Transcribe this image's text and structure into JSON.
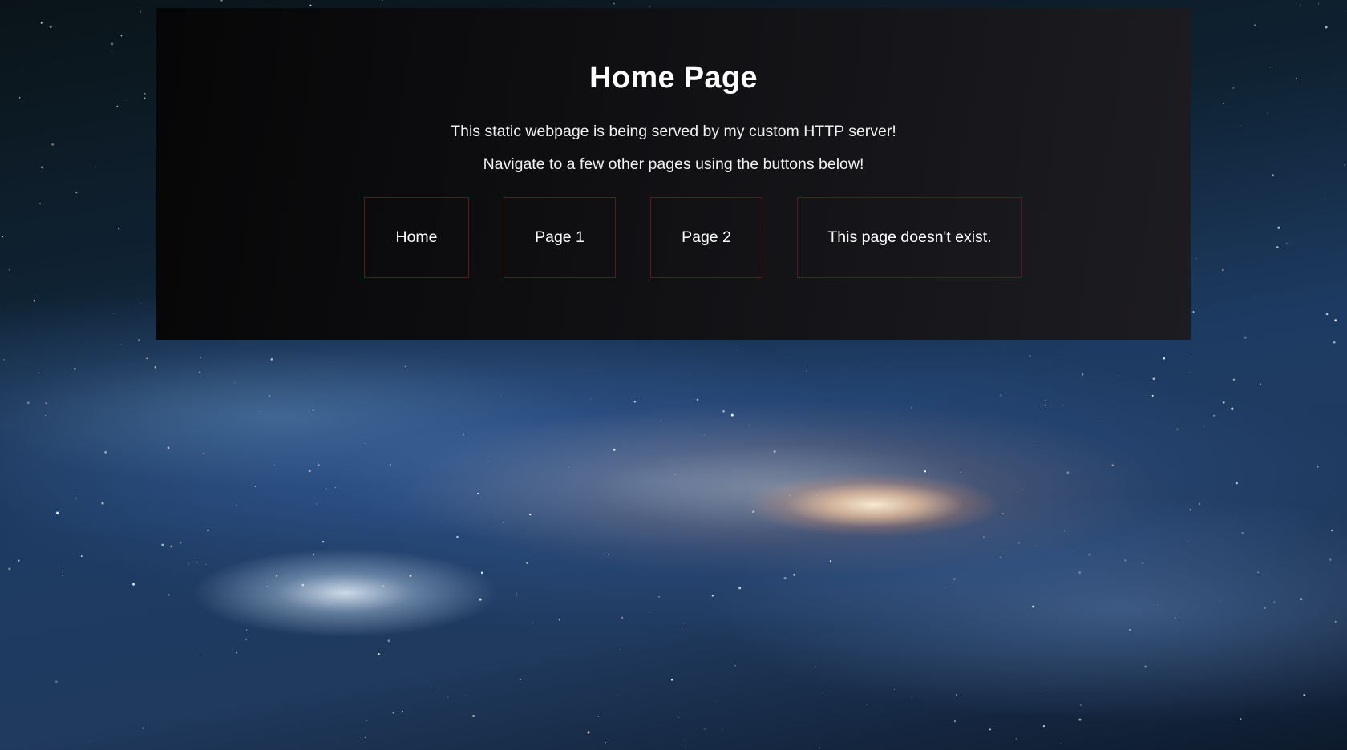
{
  "page": {
    "title": "Home Page",
    "description_1": "This static webpage is being served by my custom HTTP server!",
    "description_2": "Navigate to a few other pages using the buttons below!"
  },
  "nav": {
    "buttons": [
      {
        "label": "Home"
      },
      {
        "label": "Page 1"
      },
      {
        "label": "Page 2"
      },
      {
        "label": "This page doesn't exist."
      }
    ]
  },
  "colors": {
    "panel_background": "#101013",
    "button_border": "#5a1a1e",
    "text": "#ffffff"
  },
  "background": {
    "image": "galaxy-background"
  }
}
